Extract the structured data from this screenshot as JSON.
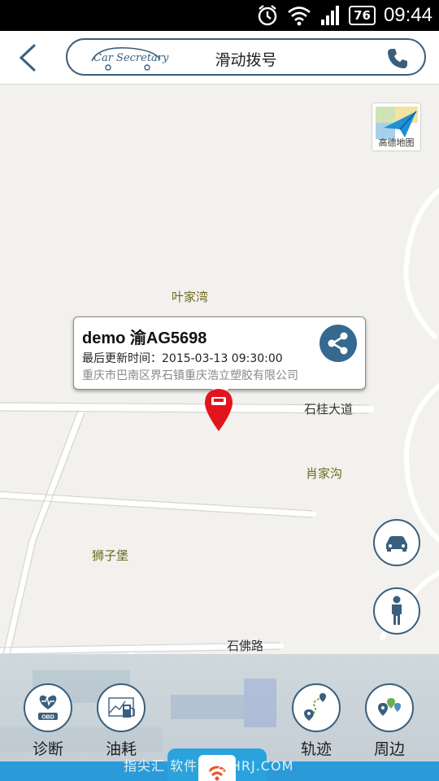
{
  "status_bar": {
    "battery": "76",
    "time": "09:44"
  },
  "header": {
    "logo_text": "Car Secretary",
    "title": "滑动拨号"
  },
  "map": {
    "gaode_label": "高德地图",
    "places": [
      "叶家湾",
      "肖家沟",
      "狮子堡"
    ],
    "roads": [
      "石桂大道",
      "石佛路"
    ]
  },
  "popup": {
    "title": "demo 渝AG5698",
    "updated": "最后更新时间：2015-03-13 09:30:00",
    "address": "重庆市巴南区界石镇重庆浩立塑胶有限公司"
  },
  "bottom_nav": [
    {
      "label": "诊断",
      "icon": "obd-heart-icon"
    },
    {
      "label": "油耗",
      "icon": "fuel-pump-icon"
    },
    {
      "label": "轨迹",
      "icon": "track-route-icon"
    },
    {
      "label": "周边",
      "icon": "nearby-pins-icon"
    }
  ],
  "watermark": "指尖汇 软件网 ZJHRJ.COM",
  "colors": {
    "accent": "#3a5f7d",
    "share": "#35698f",
    "pin": "#e3141b",
    "strip": "#2a9bd8"
  }
}
